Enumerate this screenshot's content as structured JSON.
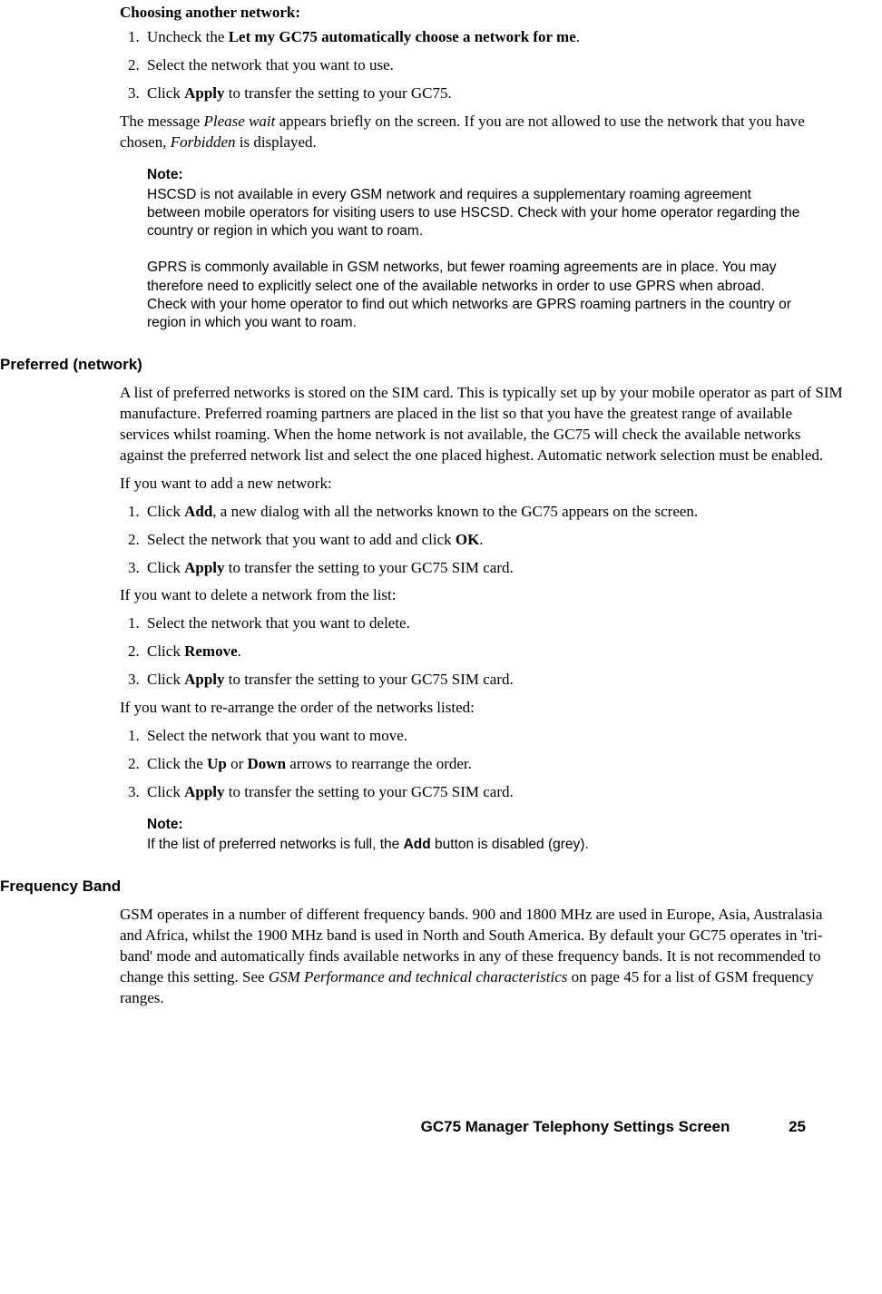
{
  "section_choose": {
    "heading": "Choosing another network:",
    "steps_prefix": [
      "1.",
      "2.",
      "3."
    ],
    "step1_a": "Uncheck the ",
    "step1_bold": "Let my GC75 automatically choose a network for me",
    "step1_b": ".",
    "step2": "Select the network that you want to use.",
    "step3_a": "Click ",
    "step3_bold": "Apply",
    "step3_b": " to transfer the setting to your GC75.",
    "para_a": "The message ",
    "para_i1": "Please wait",
    "para_b": " appears briefly on the screen. If you are not allowed to use the network that you have chosen, ",
    "para_i2": "Forbidden",
    "para_c": " is displayed."
  },
  "note1": {
    "label": "Note:",
    "p1": "HSCSD is not available in every GSM network and requires a supplementary roaming agreement between mobile operators for visiting users to use HSCSD. Check with your home operator regarding the country or region in which you want to roam.",
    "p2": "GPRS is commonly available in GSM networks, but fewer roaming agreements are in place. You may therefore need to explicitly select one of the available networks in order to use GPRS when abroad. Check with your home operator to find out which networks are GPRS roaming partners in the country or region in which you want to roam."
  },
  "section_pref": {
    "heading": "Preferred (network)",
    "intro": "A list of preferred networks is stored on the SIM card. This is typically set up by your mobile operator as part of SIM manufacture. Preferred roaming partners are placed in the list so that you have the greatest range of available services whilst roaming. When the home network is not available, the GC75 will check the available networks against the preferred network list and select the one placed highest. Automatic network selection must be enabled.",
    "add_intro": "If you want to add a new network:",
    "add1_a": "Click ",
    "add1_bold": "Add",
    "add1_b": ", a new dialog with all the networks known to the GC75 appears on the screen.",
    "add2_a": "Select the network that you want to add and click ",
    "add2_bold": "OK",
    "add2_b": ".",
    "add3_a": "Click ",
    "add3_bold": "Apply",
    "add3_b": " to transfer the setting to your GC75 SIM card.",
    "del_intro": "If you want to delete a network from the list:",
    "del1": "Select the network that you want to delete.",
    "del2_a": "Click ",
    "del2_bold": "Remove",
    "del2_b": ".",
    "del3_a": "Click ",
    "del3_bold": "Apply",
    "del3_b": " to transfer the setting to your GC75 SIM card.",
    "re_intro": "If you want to re-arrange the order of the networks listed:",
    "re1": "Select the network that you want to move.",
    "re2_a": "Click the ",
    "re2_bold1": "Up",
    "re2_mid": " or ",
    "re2_bold2": "Down",
    "re2_b": " arrows to rearrange the order.",
    "re3_a": "Click ",
    "re3_bold": "Apply",
    "re3_b": " to transfer the setting to your GC75 SIM card."
  },
  "note2": {
    "label": "Note:",
    "text_a": "If the list of preferred networks is full, the ",
    "text_bold": "Add",
    "text_b": " button is disabled (grey)."
  },
  "section_freq": {
    "heading": "Frequency Band",
    "text_a": "GSM operates in a number of different frequency bands. 900 and 1800 MHz are used in Europe, Asia, Australasia and Africa, whilst the 1900 MHz band is used in North and South America. By default your GC75 operates in 'tri-band' mode and automatically finds available networks in any of these frequency bands. It is not recommended to change this setting. See ",
    "text_italic": "GSM Performance and technical characteristics",
    "text_b": " on page 45 for a list of GSM frequency ranges."
  },
  "footer": {
    "title": "GC75 Manager Telephony Settings Screen",
    "page": "25"
  }
}
